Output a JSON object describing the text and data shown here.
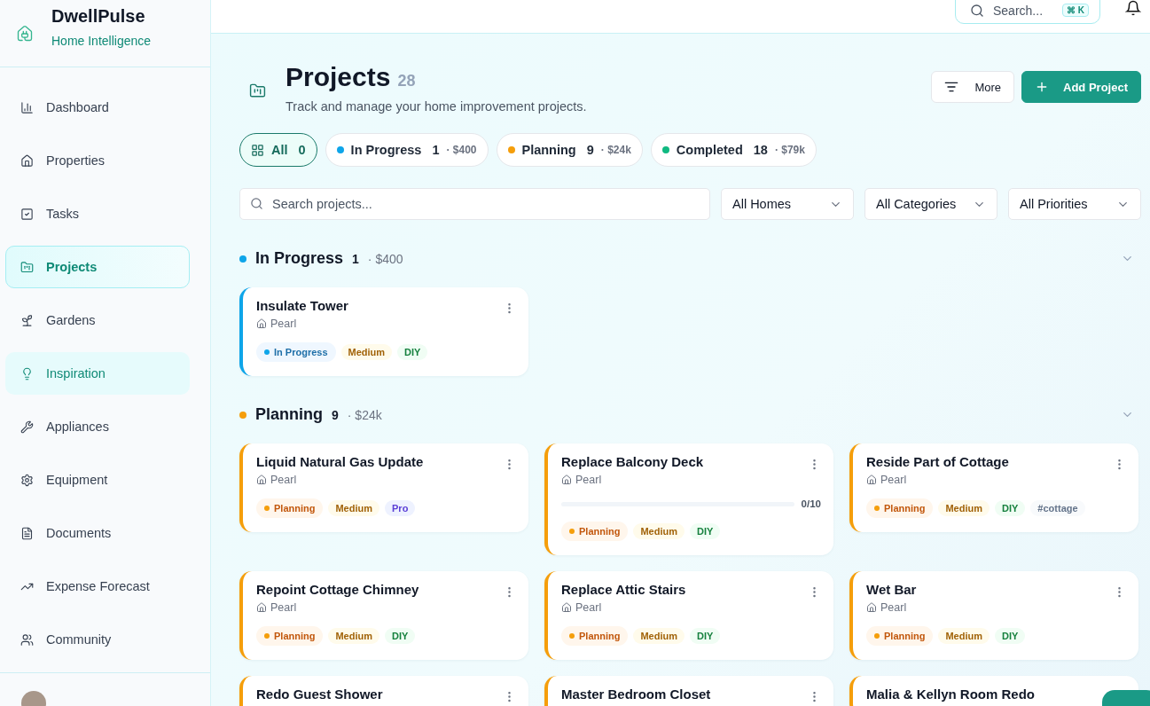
{
  "brand": {
    "name": "DwellPulse",
    "tagline": "Home Intelligence"
  },
  "sidebar": {
    "items": [
      {
        "label": "Dashboard",
        "selected": false,
        "highlighted": false
      },
      {
        "label": "Properties",
        "selected": false,
        "highlighted": false
      },
      {
        "label": "Tasks",
        "selected": false,
        "highlighted": false
      },
      {
        "label": "Projects",
        "selected": true,
        "highlighted": false
      },
      {
        "label": "Gardens",
        "selected": false,
        "highlighted": false
      },
      {
        "label": "Inspiration",
        "selected": false,
        "highlighted": true
      },
      {
        "label": "Appliances",
        "selected": false,
        "highlighted": false
      },
      {
        "label": "Equipment",
        "selected": false,
        "highlighted": false
      },
      {
        "label": "Documents",
        "selected": false,
        "highlighted": false
      },
      {
        "label": "Expense Forecast",
        "selected": false,
        "highlighted": false
      },
      {
        "label": "Community",
        "selected": false,
        "highlighted": false
      }
    ]
  },
  "topbar": {
    "search": {
      "placeholder": "Search...",
      "shortcut": "⌘ K"
    }
  },
  "page": {
    "title": "Projects",
    "count": "28",
    "subtitle": "Track and manage your home improvement projects.",
    "buttons": [
      {
        "label": "More",
        "kind": "secondary"
      },
      {
        "label": "Add Project",
        "kind": "primary"
      }
    ]
  },
  "status_tabs": [
    {
      "kind": "all",
      "label": "All",
      "count": "0",
      "selected": true
    },
    {
      "kind": "status",
      "label": "In Progress",
      "count": "1",
      "amount": "· $400",
      "color": "#0ea5e9",
      "selected": false
    },
    {
      "kind": "status",
      "label": "Planning",
      "count": "9",
      "amount": "· $24k",
      "color": "#f59e0b",
      "selected": false
    },
    {
      "kind": "status",
      "label": "Completed",
      "count": "18",
      "amount": "· $79k",
      "color": "#10b981",
      "selected": false
    }
  ],
  "filters": {
    "search": {
      "placeholder": "Search projects..."
    },
    "selects": [
      "All Homes",
      "All Categories",
      "All Priorities"
    ]
  },
  "groups": [
    {
      "title": "In Progress",
      "count": "1",
      "amount": "· $400",
      "color": "#0ea5e9",
      "expanded": true,
      "projects": [
        {
          "title": "Insulate Tower",
          "home": "Pearl",
          "status": {
            "label": "In Progress",
            "kind": "in_progress"
          },
          "tags": [
            {
              "label": "Medium",
              "kind": "priority"
            },
            {
              "label": "DIY",
              "kind": "diy"
            }
          ]
        }
      ]
    },
    {
      "title": "Planning",
      "count": "9",
      "amount": "· $24k",
      "color": "#f59e0b",
      "expanded": true,
      "projects": [
        {
          "title": "Liquid Natural Gas Update",
          "home": "Pearl",
          "status": {
            "label": "Planning",
            "kind": "planning"
          },
          "tags": [
            {
              "label": "Medium",
              "kind": "priority"
            },
            {
              "label": "Pro",
              "kind": "pro"
            }
          ]
        },
        {
          "title": "Replace Balcony Deck",
          "home": "Pearl",
          "progress": {
            "level": 0,
            "reading": "0/10"
          },
          "status": {
            "label": "Planning",
            "kind": "planning"
          },
          "tags": [
            {
              "label": "Medium",
              "kind": "priority"
            },
            {
              "label": "DIY",
              "kind": "diy"
            }
          ]
        },
        {
          "title": "Reside Part of Cottage",
          "home": "Pearl",
          "status": {
            "label": "Planning",
            "kind": "planning"
          },
          "tags": [
            {
              "label": "Medium",
              "kind": "priority"
            },
            {
              "label": "DIY",
              "kind": "diy"
            },
            {
              "label": "#cottage",
              "kind": "hashtag"
            }
          ]
        },
        {
          "title": "Repoint Cottage Chimney",
          "home": "Pearl",
          "status": {
            "label": "Planning",
            "kind": "planning"
          },
          "tags": [
            {
              "label": "Medium",
              "kind": "priority"
            },
            {
              "label": "DIY",
              "kind": "diy"
            }
          ]
        },
        {
          "title": "Replace Attic Stairs",
          "home": "Pearl",
          "status": {
            "label": "Planning",
            "kind": "planning"
          },
          "tags": [
            {
              "label": "Medium",
              "kind": "priority"
            },
            {
              "label": "DIY",
              "kind": "diy"
            }
          ]
        },
        {
          "title": "Wet Bar",
          "home": "Pearl",
          "status": {
            "label": "Planning",
            "kind": "planning"
          },
          "tags": [
            {
              "label": "Medium",
              "kind": "priority"
            },
            {
              "label": "DIY",
              "kind": "diy"
            }
          ]
        },
        {
          "title": "Redo Guest Shower"
        },
        {
          "title": "Master Bedroom Closet"
        },
        {
          "title": "Malia & Kellyn Room Redo",
          "menu": false
        }
      ]
    }
  ]
}
